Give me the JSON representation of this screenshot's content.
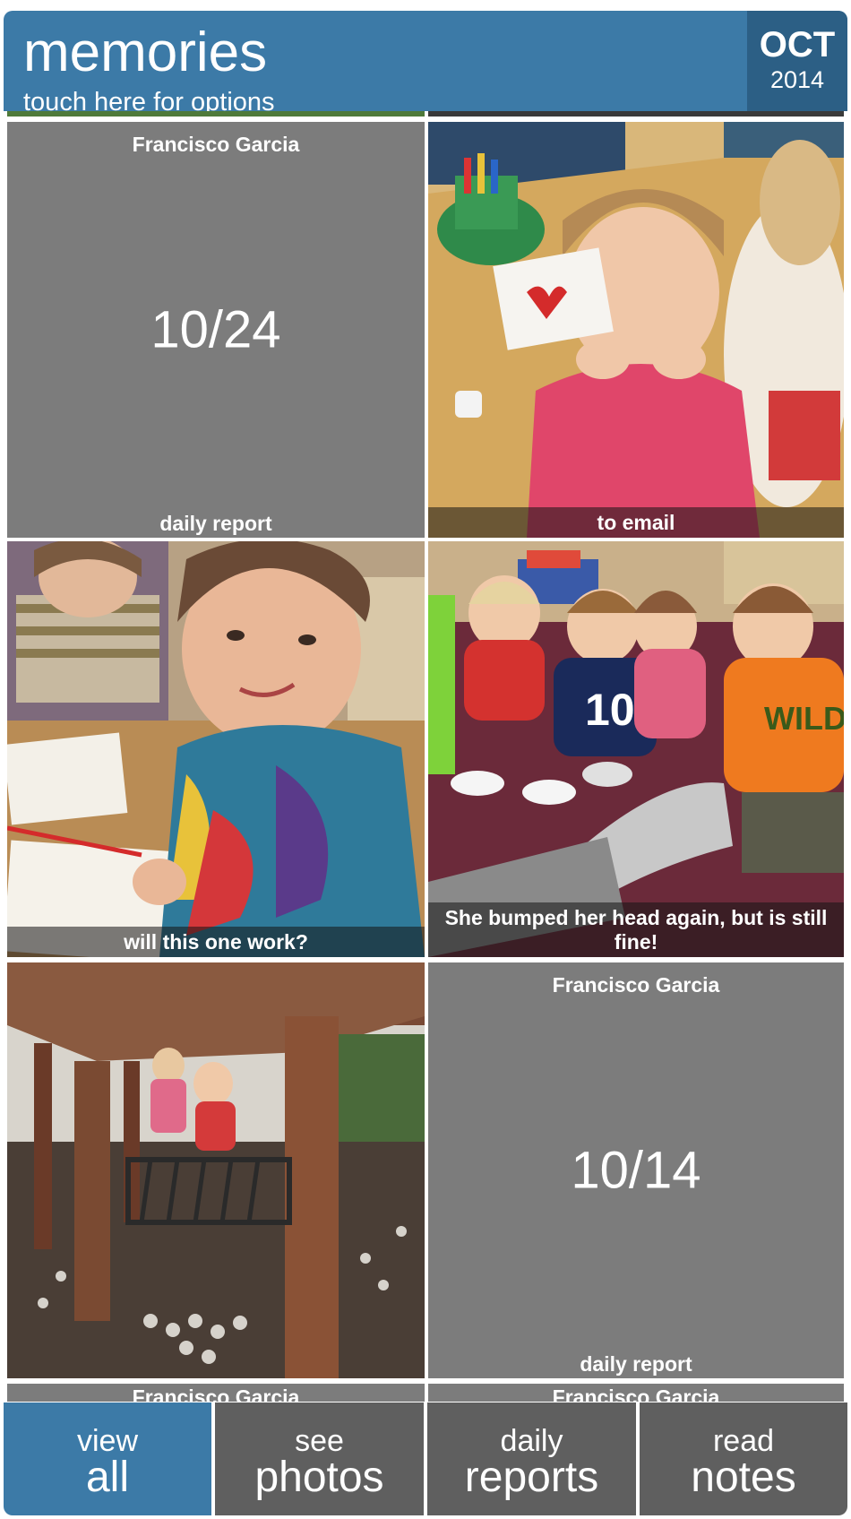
{
  "header": {
    "title": "memories",
    "subtitle": "touch here for options",
    "month": "OCT",
    "year": "2014"
  },
  "tiles": [
    {
      "type": "report",
      "name": "Francisco Garcia",
      "date": "10/24",
      "label": "daily report"
    },
    {
      "type": "photo",
      "caption": "to email"
    },
    {
      "type": "photo",
      "caption": "will this one work?"
    },
    {
      "type": "photo",
      "caption": "She bumped her head again, but is still fine!"
    },
    {
      "type": "photo",
      "caption": ""
    },
    {
      "type": "report",
      "name": "Francisco Garcia",
      "date": "10/14",
      "label": "daily report"
    }
  ],
  "partial_row": {
    "left_name": "Francisco Garcia",
    "right_name": "Francisco Garcia"
  },
  "nav": [
    {
      "small": "view",
      "big": "all",
      "active": true
    },
    {
      "small": "see",
      "big": "photos",
      "active": false
    },
    {
      "small": "daily",
      "big": "reports",
      "active": false
    },
    {
      "small": "read",
      "big": "notes",
      "active": false
    }
  ],
  "colors": {
    "accent": "#3c7aa7",
    "accent_dark": "#2c5f85",
    "tile_gray": "#7c7c7c",
    "nav_gray": "#5f5f5f"
  }
}
